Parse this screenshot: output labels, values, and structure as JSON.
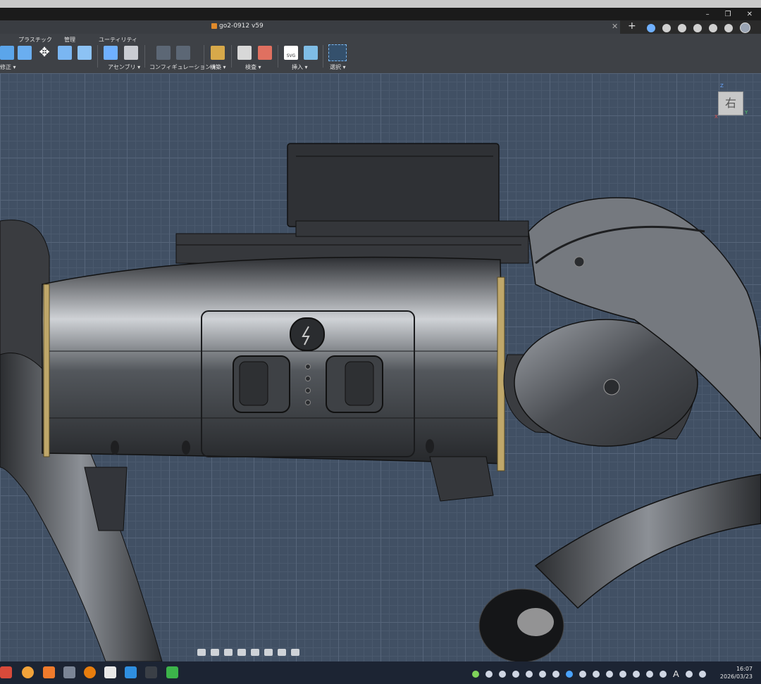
{
  "window": {
    "controls": [
      "–",
      "❐",
      "✕"
    ]
  },
  "document_tab": {
    "title": "go2-0912 v59",
    "close": "✕",
    "add": "+"
  },
  "ribbon": {
    "groups": {
      "plastic": "プラスチック",
      "manage": "管理",
      "utility": "ユーティリティ"
    },
    "subs": {
      "modify": "修正 ▾",
      "assembly": "アセンブリ ▾",
      "configuration": "コンフィギュレーション ▾",
      "construct": "構築 ▾",
      "inspect": "検査 ▾",
      "insert": "挿入 ▾",
      "select": "選択 ▾"
    },
    "svg_badge": "SVG"
  },
  "viewcube": {
    "face": "右",
    "axes": {
      "z": "Z",
      "y": "Y",
      "x": "X"
    }
  },
  "clock": {
    "time": "16:07",
    "date": "2026/03/23"
  },
  "tray": {
    "ime": "A"
  },
  "colors": {
    "viewport_bg": "#415064",
    "ribbon_bg": "#3e4146",
    "taskbar_bg": "#1c2433",
    "accent": "#6fb0ff"
  }
}
